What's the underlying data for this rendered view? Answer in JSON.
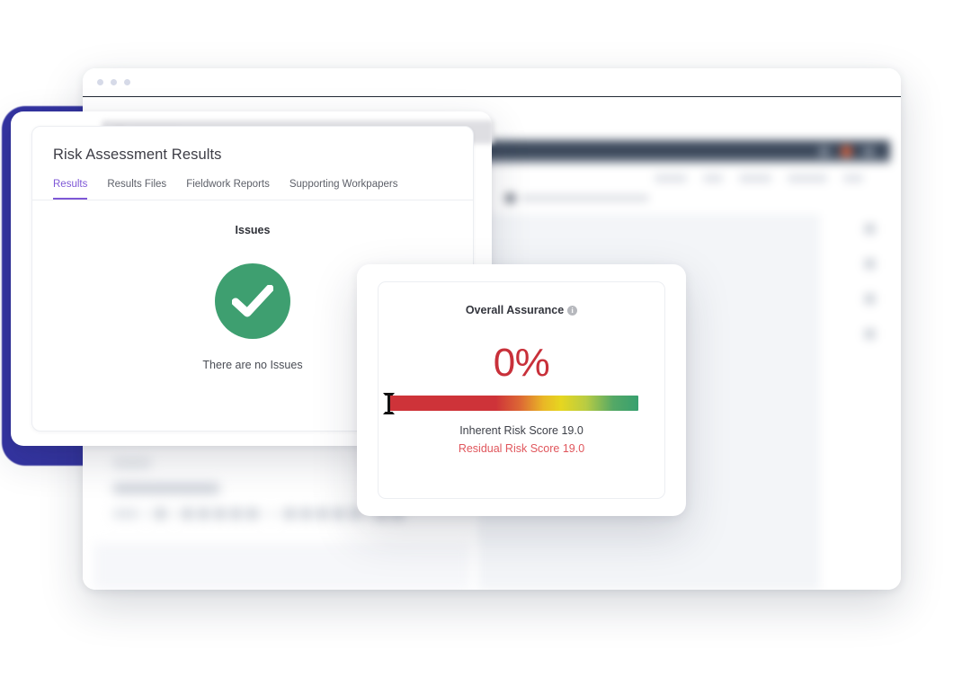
{
  "browser": {
    "dots": [
      "dot-1",
      "dot-2",
      "dot-3"
    ]
  },
  "background_app": {
    "nav_items": [
      "nav-item-1",
      "nav-item-2",
      "nav-item-3",
      "nav-item-4",
      "nav-item-5"
    ],
    "rail_icons": [
      "rail-icon-1",
      "rail-icon-2",
      "rail-icon-3",
      "rail-icon-4"
    ],
    "topbar_icons": [
      "window-icon",
      "alert-icon",
      "user-icon"
    ]
  },
  "panel": {
    "title": "Risk Assessment Results",
    "tabs": [
      {
        "label": "Results",
        "active": true
      },
      {
        "label": "Results Files",
        "active": false
      },
      {
        "label": "Fieldwork Reports",
        "active": false
      },
      {
        "label": "Supporting Workpapers",
        "active": false
      }
    ],
    "issues": {
      "heading": "Issues",
      "status_icon": "check-circle-icon",
      "empty_message": "There are no Issues",
      "accent_color": "#3e9f70"
    }
  },
  "assurance": {
    "title": "Overall Assurance",
    "info_icon": "info-icon",
    "info_glyph": "i",
    "percent": "0%",
    "percent_color": "#c8303a",
    "inherent_risk": "Inherent Risk Score 19.0",
    "residual_risk": "Residual Risk Score 19.0",
    "residual_color": "#e0565c",
    "gauge": {
      "name": "assurance-gauge",
      "value": 0,
      "min": 0,
      "max": 100,
      "gradient_stops": [
        "#ce3339",
        "#dd6a34",
        "#e9b726",
        "#e6d620",
        "#b9cc43",
        "#37a06f"
      ]
    },
    "cursor_icon": "text-ibeam-cursor"
  },
  "theme": {
    "tab_active_color": "#7e57d6",
    "navy_layer_color": "#3434a2",
    "app_topbar_color": "#3e4b5e"
  }
}
